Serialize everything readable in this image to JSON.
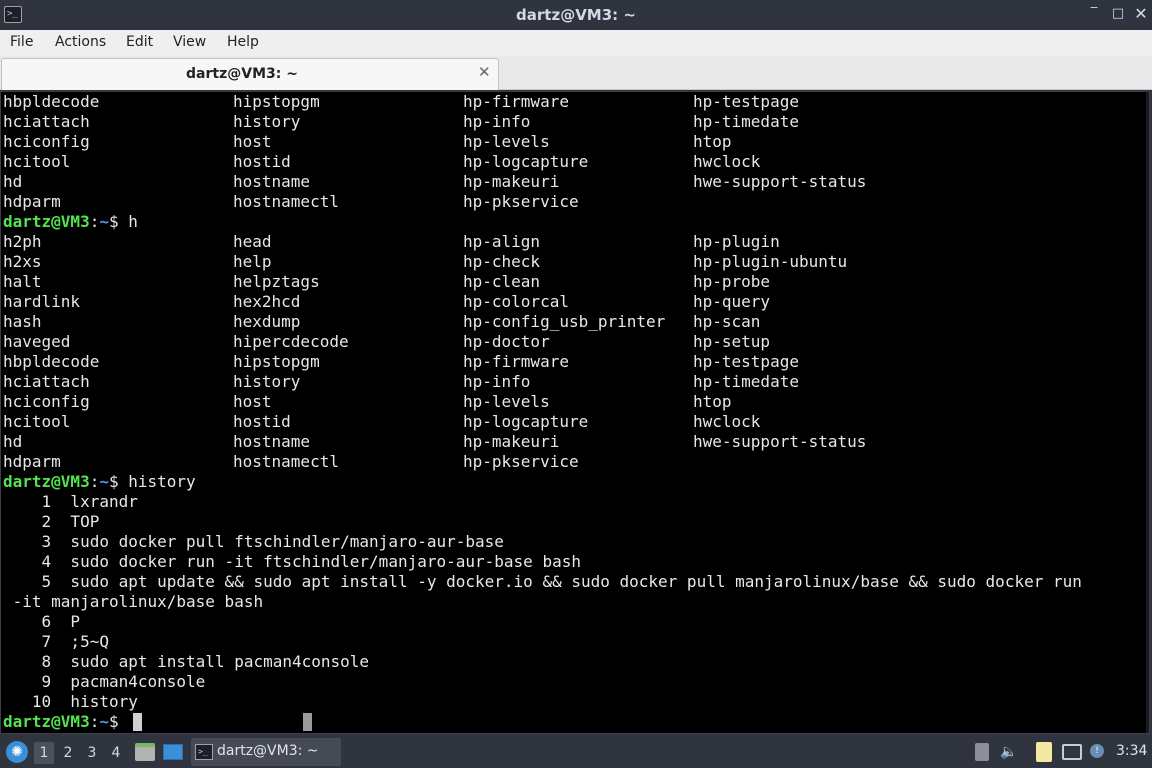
{
  "window": {
    "title": "dartz@VM3: ~",
    "icon": "terminal-icon",
    "controls": {
      "minimize": "‾",
      "maximize": "□",
      "close": "✕"
    }
  },
  "menu": [
    "File",
    "Actions",
    "Edit",
    "View",
    "Help"
  ],
  "tab": {
    "label": "dartz@VM3: ~",
    "close": "✕"
  },
  "prompt": {
    "user": "dartz@VM3",
    "sep": ":",
    "path": "~",
    "symbol": "$ "
  },
  "terminal": {
    "completion_rows_top": [
      [
        "hbpldecode",
        "hipstopgm",
        "hp-firmware",
        "hp-testpage"
      ],
      [
        "hciattach",
        "history",
        "hp-info",
        "hp-timedate"
      ],
      [
        "hciconfig",
        "host",
        "hp-levels",
        "htop"
      ],
      [
        "hcitool",
        "hostid",
        "hp-logcapture",
        "hwclock"
      ],
      [
        "hd",
        "hostname",
        "hp-makeuri",
        "hwe-support-status"
      ],
      [
        "hdparm",
        "hostnamectl",
        "hp-pkservice",
        ""
      ]
    ],
    "command_1": "h",
    "completion_rows_bottom": [
      [
        "h2ph",
        "head",
        "hp-align",
        "hp-plugin"
      ],
      [
        "h2xs",
        "help",
        "hp-check",
        "hp-plugin-ubuntu"
      ],
      [
        "halt",
        "helpztags",
        "hp-clean",
        "hp-probe"
      ],
      [
        "hardlink",
        "hex2hcd",
        "hp-colorcal",
        "hp-query"
      ],
      [
        "hash",
        "hexdump",
        "hp-config_usb_printer",
        "hp-scan"
      ],
      [
        "haveged",
        "hipercdecode",
        "hp-doctor",
        "hp-setup"
      ],
      [
        "hbpldecode",
        "hipstopgm",
        "hp-firmware",
        "hp-testpage"
      ],
      [
        "hciattach",
        "history",
        "hp-info",
        "hp-timedate"
      ],
      [
        "hciconfig",
        "host",
        "hp-levels",
        "htop"
      ],
      [
        "hcitool",
        "hostid",
        "hp-logcapture",
        "hwclock"
      ],
      [
        "hd",
        "hostname",
        "hp-makeuri",
        "hwe-support-status"
      ],
      [
        "hdparm",
        "hostnamectl",
        "hp-pkservice",
        ""
      ]
    ],
    "command_2": "history",
    "history_lines": [
      "    1  lxrandr",
      "    2  TOP",
      "    3  sudo docker pull ftschindler/manjaro-aur-base",
      "    4  sudo docker run -it ftschindler/manjaro-aur-base bash",
      "    5  sudo apt update && sudo apt install -y docker.io && sudo docker pull manjarolinux/base && sudo docker run",
      " -it manjarolinux/base bash",
      "    6  P",
      "    7  ;5~Q",
      "    8  sudo apt install pacman4console",
      "    9  pacman4console",
      "   10  history"
    ]
  },
  "taskbar": {
    "start_icon": "lubuntu-logo-icon",
    "workspaces": [
      "1",
      "2",
      "3",
      "4"
    ],
    "active_workspace": "1",
    "launchers": [
      "file-manager-icon",
      "show-desktop-icon"
    ],
    "task_label": "dartz@VM3: ~",
    "tray_icons": [
      "keyboard-icon",
      "volume-icon",
      "notes-icon",
      "network-icon",
      "updates-icon"
    ],
    "clock": "3:34"
  },
  "colors": {
    "prompt_user": "#53e34f",
    "prompt_path": "#5e8fe6",
    "terminal_bg": "#000000",
    "terminal_fg": "#e8e8e8",
    "panel_bg": "#2f343f"
  }
}
